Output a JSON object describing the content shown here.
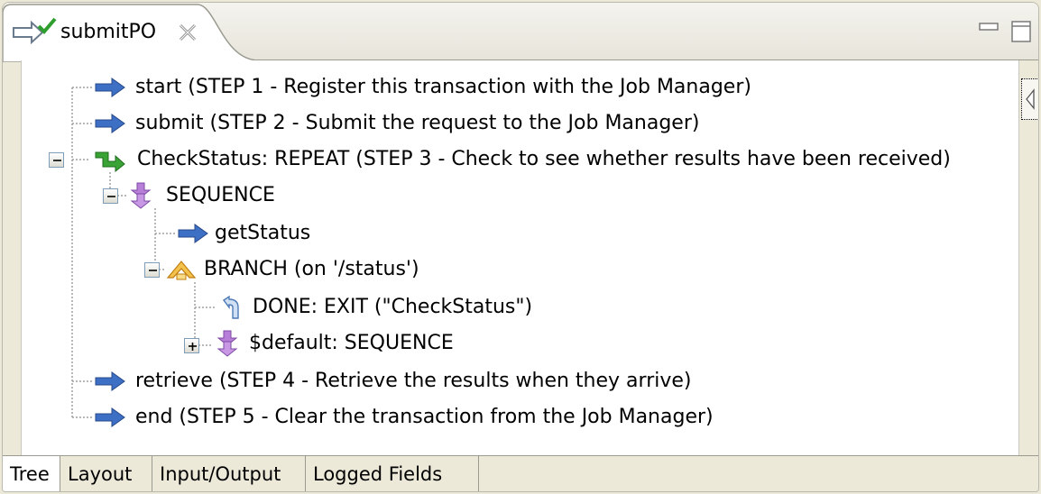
{
  "editor": {
    "tab_title": "submitPO",
    "close_icon": "close-x-icon",
    "minimize_icon": "minimize-icon",
    "maximize_icon": "maximize-icon"
  },
  "tree": {
    "items": [
      {
        "label": "start (STEP 1 - Register this transaction with the Job Manager)",
        "icon": "call-arrow-icon"
      },
      {
        "label": "submit (STEP 2 - Submit the request to the Job Manager)",
        "icon": "call-arrow-icon"
      },
      {
        "label": "CheckStatus: REPEAT (STEP 3 - Check to see whether results have been received)",
        "icon": "repeat-icon",
        "expanded": true
      },
      {
        "label": "SEQUENCE",
        "icon": "sequence-icon",
        "expanded": true
      },
      {
        "label": "getStatus",
        "icon": "call-arrow-icon"
      },
      {
        "label": "BRANCH (on '/status')",
        "icon": "branch-icon",
        "expanded": true
      },
      {
        "label": "DONE: EXIT (\"CheckStatus\")",
        "icon": "exit-icon"
      },
      {
        "label": "$default: SEQUENCE",
        "icon": "sequence-icon",
        "expanded": false
      },
      {
        "label": "retrieve (STEP 4 - Retrieve the results when they arrive)",
        "icon": "call-arrow-icon"
      },
      {
        "label": "end (STEP 5 - Clear the transaction from the Job Manager)",
        "icon": "call-arrow-icon"
      }
    ]
  },
  "bottom_tabs": [
    {
      "label": "Tree",
      "active": true
    },
    {
      "label": "Layout"
    },
    {
      "label": "Input/Output"
    },
    {
      "label": "Logged Fields"
    }
  ],
  "colors": {
    "arrow_blue": "#3d6fc4",
    "repeat_green": "#3aa336",
    "sequence_purple": "#b77fd8",
    "branch_orange": "#e8a526",
    "panel_background": "#ece9d8"
  }
}
